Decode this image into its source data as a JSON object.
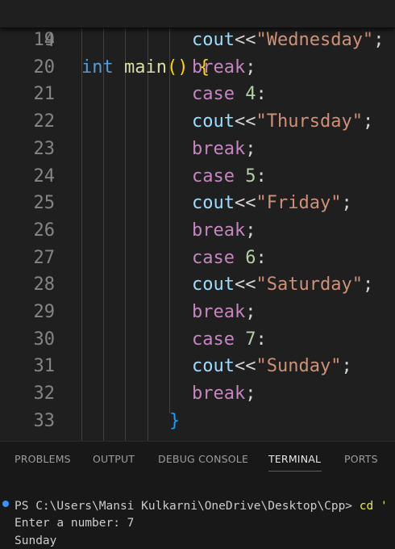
{
  "editor": {
    "sticky": {
      "line_number": "4",
      "type": "int",
      "func": "main",
      "parens": "()",
      "brace": "{"
    },
    "lines": [
      {
        "n": "19",
        "kind": "cout",
        "text": "\"Wednesday\""
      },
      {
        "n": "20",
        "kind": "break"
      },
      {
        "n": "21",
        "kind": "case",
        "num": "4"
      },
      {
        "n": "22",
        "kind": "cout",
        "text": "\"Thursday\""
      },
      {
        "n": "23",
        "kind": "break"
      },
      {
        "n": "24",
        "kind": "case",
        "num": "5"
      },
      {
        "n": "25",
        "kind": "cout",
        "text": "\"Friday\""
      },
      {
        "n": "26",
        "kind": "break"
      },
      {
        "n": "27",
        "kind": "case",
        "num": "6"
      },
      {
        "n": "28",
        "kind": "cout",
        "text": "\"Saturday\""
      },
      {
        "n": "29",
        "kind": "break"
      },
      {
        "n": "30",
        "kind": "case",
        "num": "7"
      },
      {
        "n": "31",
        "kind": "cout",
        "text": "\"Sunday\""
      },
      {
        "n": "32",
        "kind": "break"
      },
      {
        "n": "33",
        "kind": "close",
        "text": "}"
      }
    ],
    "tokens": {
      "cout": "cout",
      "op": "<<",
      "semi": ";",
      "break": "break",
      "case": "case",
      "colon": ":"
    }
  },
  "panel": {
    "tabs": [
      {
        "label": "PROBLEMS",
        "active": false
      },
      {
        "label": "OUTPUT",
        "active": false
      },
      {
        "label": "DEBUG CONSOLE",
        "active": false
      },
      {
        "label": "TERMINAL",
        "active": true
      },
      {
        "label": "PORTS",
        "active": false
      }
    ],
    "terminal": {
      "prompt": "PS C:\\Users\\Mansi Kulkarni\\OneDrive\\Desktop\\Cpp> ",
      "command": "cd '",
      "output": [
        "Enter a number: 7",
        "Sunday"
      ]
    }
  },
  "colors": {
    "background": "#1f1f1f",
    "control_keyword": "#c586c0",
    "type_keyword": "#569cd6",
    "string": "#ce9178",
    "variable": "#9cdcfe",
    "number": "#b5cea8",
    "active_tab_underline": "#0078d4"
  }
}
